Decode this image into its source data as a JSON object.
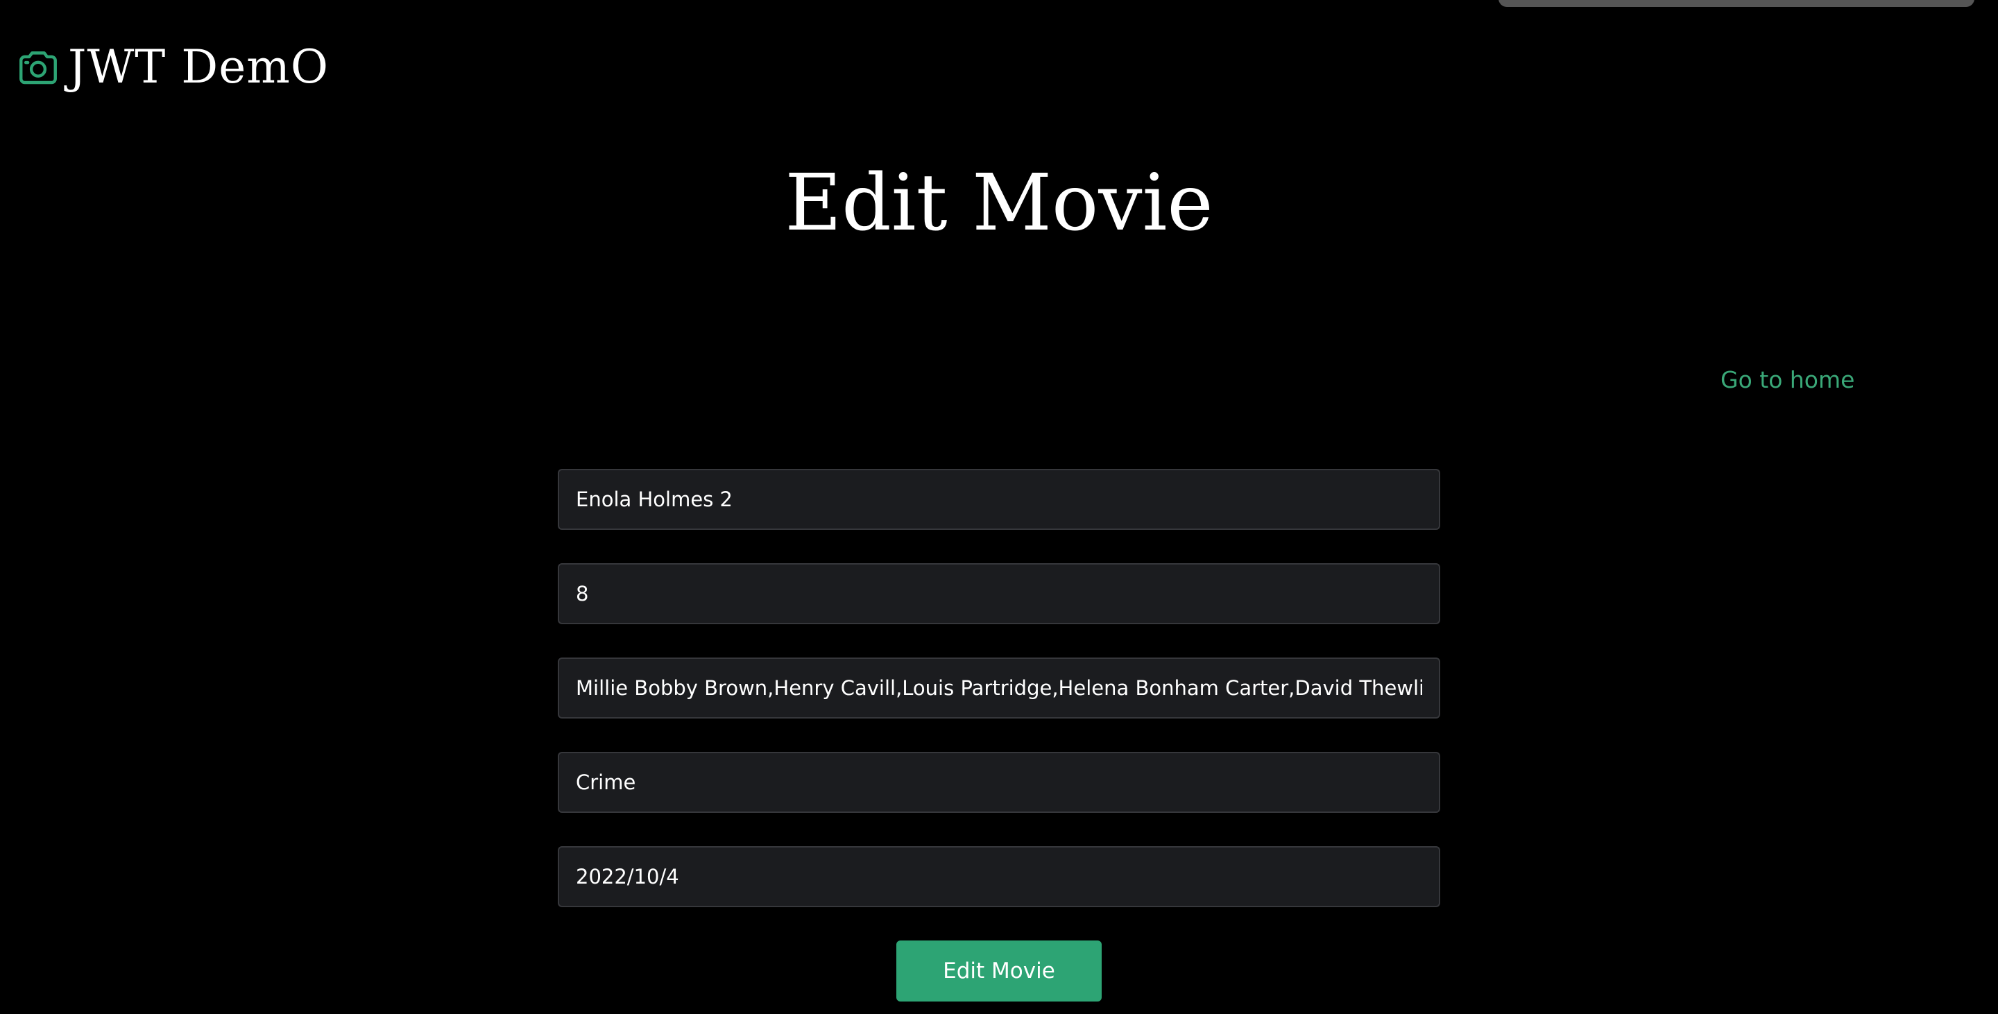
{
  "header": {
    "brand_title": "JWT DemO",
    "brand_icon": "camera-icon",
    "accent_color": "#2da474"
  },
  "main": {
    "title": "Edit Movie",
    "home_link_label": "Go to home"
  },
  "form": {
    "fields": [
      {
        "name": "title",
        "value": "Enola Holmes 2"
      },
      {
        "name": "rating",
        "value": "8"
      },
      {
        "name": "cast",
        "value": "Millie Bobby Brown,Henry Cavill,Louis Partridge,Helena Bonham Carter,David Thewlis"
      },
      {
        "name": "genre",
        "value": "Crime"
      },
      {
        "name": "release_date",
        "value": "2022/10/4"
      }
    ],
    "submit_label": "Edit Movie"
  }
}
